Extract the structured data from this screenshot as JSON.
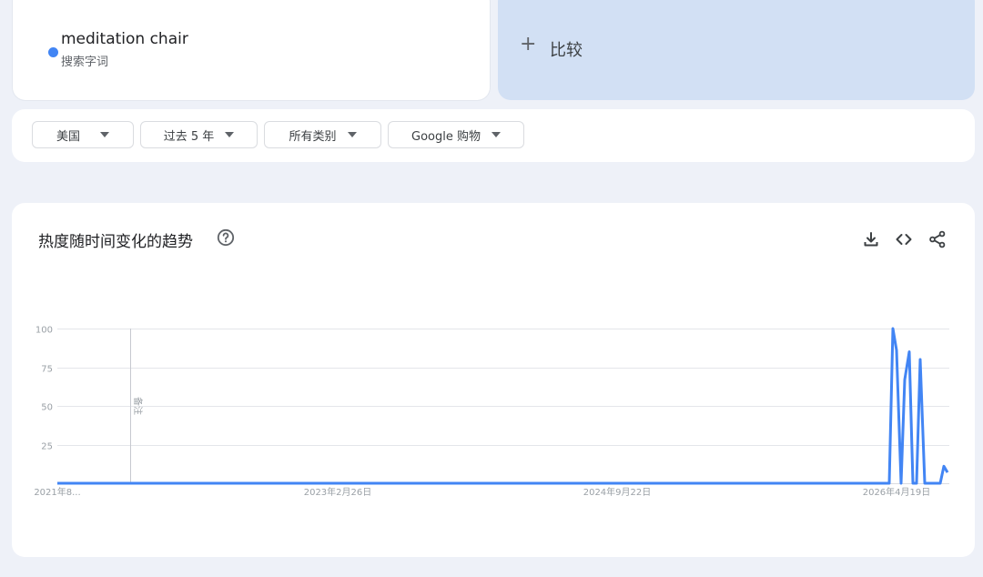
{
  "search_term": {
    "name": "meditation chair",
    "type_label": "搜索字词",
    "color": "#4285f4"
  },
  "compare": {
    "plus": "+",
    "label": "比较"
  },
  "filters": [
    {
      "label": "美国"
    },
    {
      "label": "过去 5 年"
    },
    {
      "label": "所有类别"
    },
    {
      "label": "Google 购物"
    }
  ],
  "chart_section": {
    "title": "热度随时间变化的趋势",
    "icons": [
      "help-icon",
      "download-icon",
      "embed-code-icon",
      "share-icon"
    ]
  },
  "chart_data": {
    "type": "line",
    "title": "",
    "xlabel": "",
    "ylabel": "",
    "ylim": [
      0,
      100
    ],
    "y_ticks": [
      100,
      75,
      50,
      25
    ],
    "x_tick_labels": [
      "2021年8...",
      "2023年2月26日",
      "2024年9月22日",
      "2026年4月19日"
    ],
    "annotation": "备注",
    "grid": true,
    "series": [
      {
        "color": "#4285f4",
        "points": [
          {
            "x": "2021年8...",
            "y": 0
          },
          {
            "x": "2026年4月12日",
            "y": 0
          },
          {
            "x": "2026年4月19日",
            "y": 100
          },
          {
            "x": "2026年4月20日",
            "y": 86
          },
          {
            "x": "2026年4月22日",
            "y": 0
          },
          {
            "x": "2026年4月24日",
            "y": 67
          },
          {
            "x": "2026年4月25日",
            "y": 85
          },
          {
            "x": "2026年4月26日",
            "y": 0
          },
          {
            "x": "2026年4月28日",
            "y": 0
          },
          {
            "x": "2026年4月29日",
            "y": 80
          },
          {
            "x": "2026年4月30日",
            "y": 0
          },
          {
            "x": "2026年5月",
            "y": 0
          },
          {
            "x": "2026年5月",
            "y": 11
          },
          {
            "x": "2026年5月",
            "y": 7
          }
        ]
      }
    ]
  }
}
